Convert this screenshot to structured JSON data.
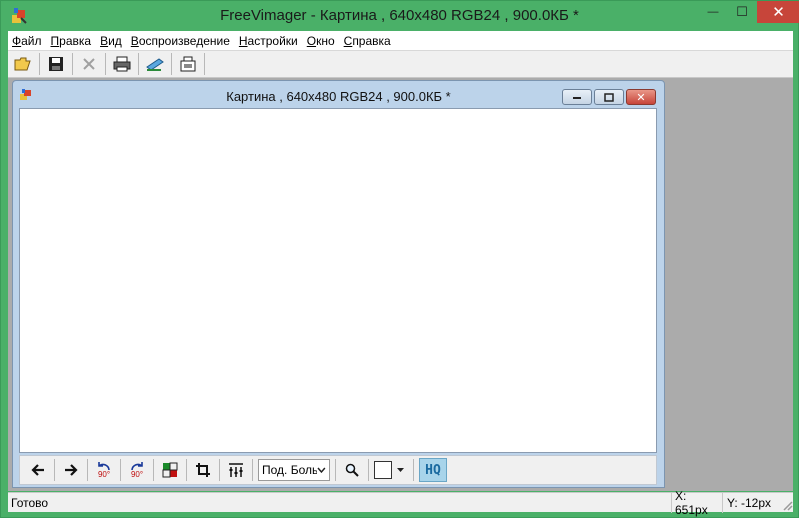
{
  "app": {
    "title": "FreeVimager - Картина , 640x480 RGB24 , 900.0КБ *",
    "minimize_glyph": "—",
    "maximize_glyph": "☐",
    "close_glyph": "✕"
  },
  "menu": {
    "items": [
      "Файл",
      "Правка",
      "Вид",
      "Воспроизведение",
      "Настройки",
      "Окно",
      "Справка"
    ]
  },
  "toolbar": {
    "icons": [
      "open-folder-icon",
      "save-icon",
      "delete-icon",
      "print-icon",
      "scan-icon",
      "screen-capture-icon"
    ]
  },
  "child_window": {
    "title": "Картина , 640x480 RGB24 , 900.0КБ *",
    "zoom_select_value": "Под. Больше",
    "rotate_ccw_label": "90°",
    "rotate_cw_label": "90°",
    "hq_label": "HQ"
  },
  "status": {
    "text": "Готово",
    "x": "X: 651px",
    "y": "Y: -12px"
  },
  "colors": {
    "frame_green": "#4ab068",
    "mdi_background": "#ababab",
    "child_frame": "#bcd3ea",
    "close_red": "#c7453a"
  }
}
